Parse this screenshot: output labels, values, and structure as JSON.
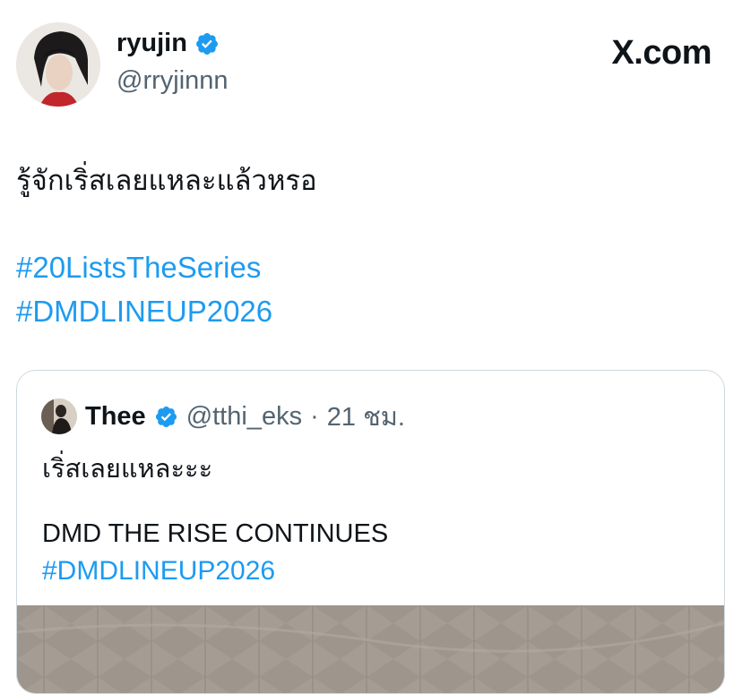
{
  "author": {
    "name": "ryujin",
    "handle": "@rryjinnn",
    "verified": true
  },
  "brand": "X.com",
  "tweet": {
    "text": "รู้จักเริ่สเลยแหละแล้วหรอ",
    "hashtags": [
      "#20ListsTheSeries",
      "#DMDLINEUP2026"
    ]
  },
  "quote": {
    "name": "Thee",
    "handle": "@tthi_eks",
    "separator": "·",
    "time": "21 ชม.",
    "line1": "เริ่สเลยแหละะะ",
    "line2": "DMD THE RISE CONTINUES",
    "hashtag": "#DMDLINEUP2026"
  },
  "colors": {
    "accent": "#1d9bf0",
    "verified": "#1d9bf0",
    "text": "#0f1419",
    "muted": "#536471",
    "border": "#cfd9de"
  }
}
